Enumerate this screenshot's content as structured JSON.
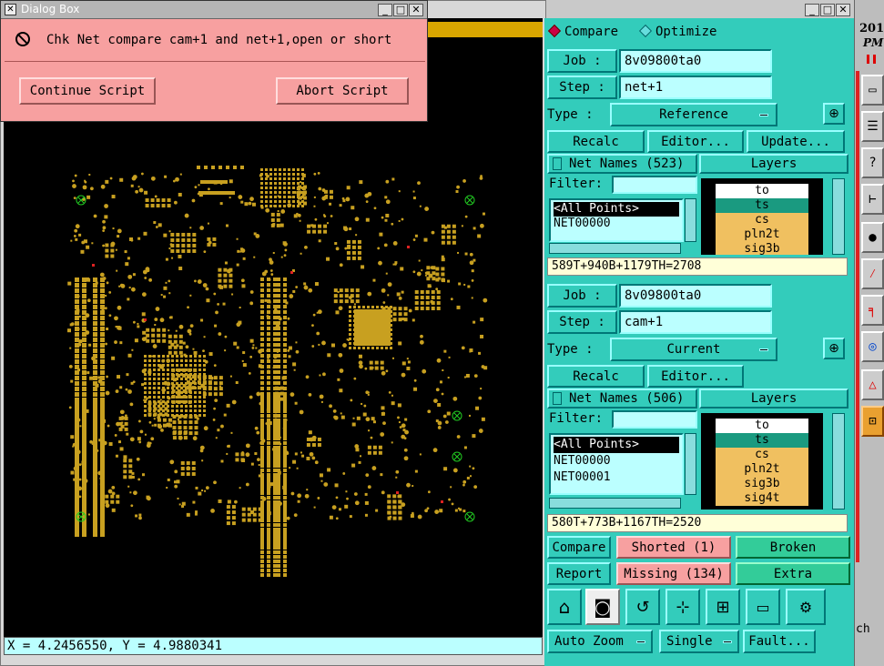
{
  "dialog": {
    "title": "Dialog Box",
    "message": "Chk Net compare cam+1 and net+1,open or short",
    "continue_label": "Continue Script",
    "abort_label": "Abort Script"
  },
  "graphic": {
    "coords": "X = 4.2456550, Y = 4.9880341",
    "colors": {
      "background": "#000000",
      "copper": "#c8a020",
      "marker": "#22cc22",
      "error": "#dd2222"
    }
  },
  "compare_panel": {
    "mode_compare": "Compare",
    "mode_optimize": "Optimize",
    "reference": {
      "job_label": "Job  :",
      "job_value": "8v09800ta0",
      "step_label": "Step  :",
      "step_value": "net+1",
      "type_label": "Type :",
      "type_value": "Reference",
      "recalc": "Recalc",
      "editor": "Editor...",
      "update": "Update...",
      "net_names": "Net Names (523)",
      "layers_header": "Layers",
      "filter_label": "Filter:",
      "nets": [
        "<All Points>",
        "NET00000"
      ],
      "layers": [
        "to",
        "ts",
        "cs",
        "pln2t",
        "sig3b"
      ],
      "summary": "589T+940B+1179TH=2708"
    },
    "current": {
      "job_label": "Job  :",
      "job_value": "8v09800ta0",
      "step_label": "Step  :",
      "step_value": "cam+1",
      "type_label": "Type :",
      "type_value": "Current",
      "recalc": "Recalc",
      "editor": "Editor...",
      "net_names": "Net Names (506)",
      "layers_header": "Layers",
      "filter_label": "Filter:",
      "nets": [
        "<All Points>",
        "NET00000",
        "NET00001"
      ],
      "layers": [
        "to",
        "ts",
        "cs",
        "pln2t",
        "sig3b",
        "sig4t"
      ],
      "summary": "580T+773B+1167TH=2520"
    },
    "results": {
      "compare": "Compare",
      "shorted": "Shorted (1)",
      "broken": "Broken",
      "report": "Report",
      "missing": "Missing (134)",
      "extra": "Extra"
    },
    "bottom": {
      "auto_zoom": "Auto Zoom",
      "single": "Single",
      "fault": "Fault..."
    }
  },
  "side_panel": {
    "year": "201",
    "ampm": "PM",
    "stub": "ch"
  }
}
